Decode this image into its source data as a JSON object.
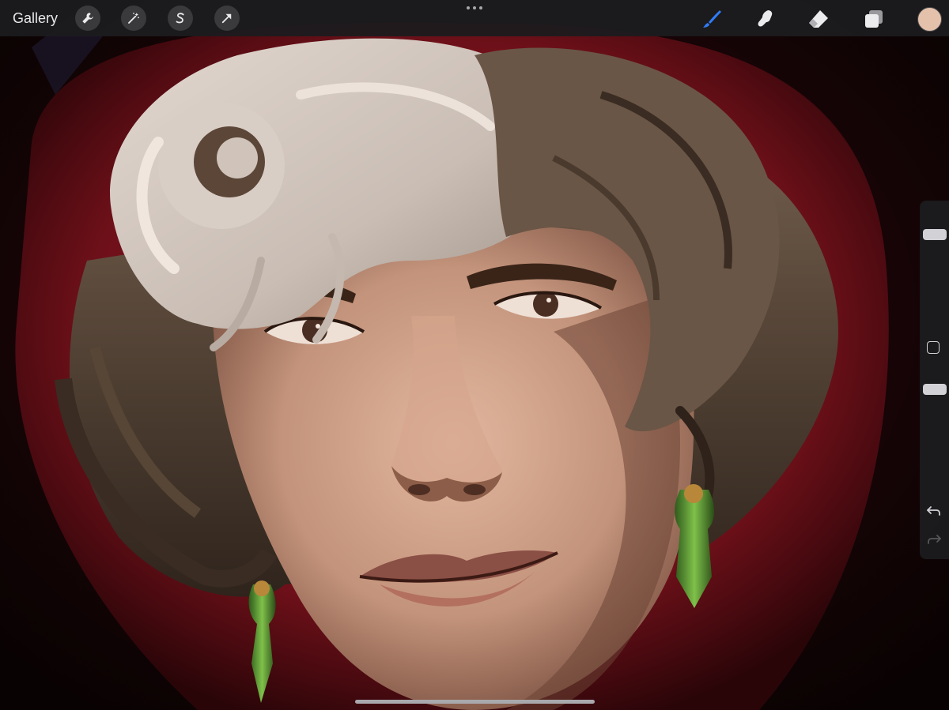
{
  "topbar": {
    "gallery_label": "Gallery",
    "actions": [
      {
        "name": "actions-wrench-icon"
      },
      {
        "name": "adjustments-magic-wand-icon"
      },
      {
        "name": "selection-s-icon"
      },
      {
        "name": "transform-arrow-icon"
      }
    ],
    "tools": [
      {
        "name": "brush-icon",
        "active": true
      },
      {
        "name": "smudge-icon",
        "active": false
      },
      {
        "name": "eraser-icon",
        "active": false
      },
      {
        "name": "layers-icon",
        "active": false
      }
    ],
    "current_color": "#e4c1ab"
  },
  "sidebar": {
    "brush_size": 0.76,
    "opacity": 0.9
  },
  "colors": {
    "accent": "#2f7bf5",
    "bar": "#1c1c1e",
    "hood_red": "#7a1420",
    "background": "#0d0505"
  }
}
